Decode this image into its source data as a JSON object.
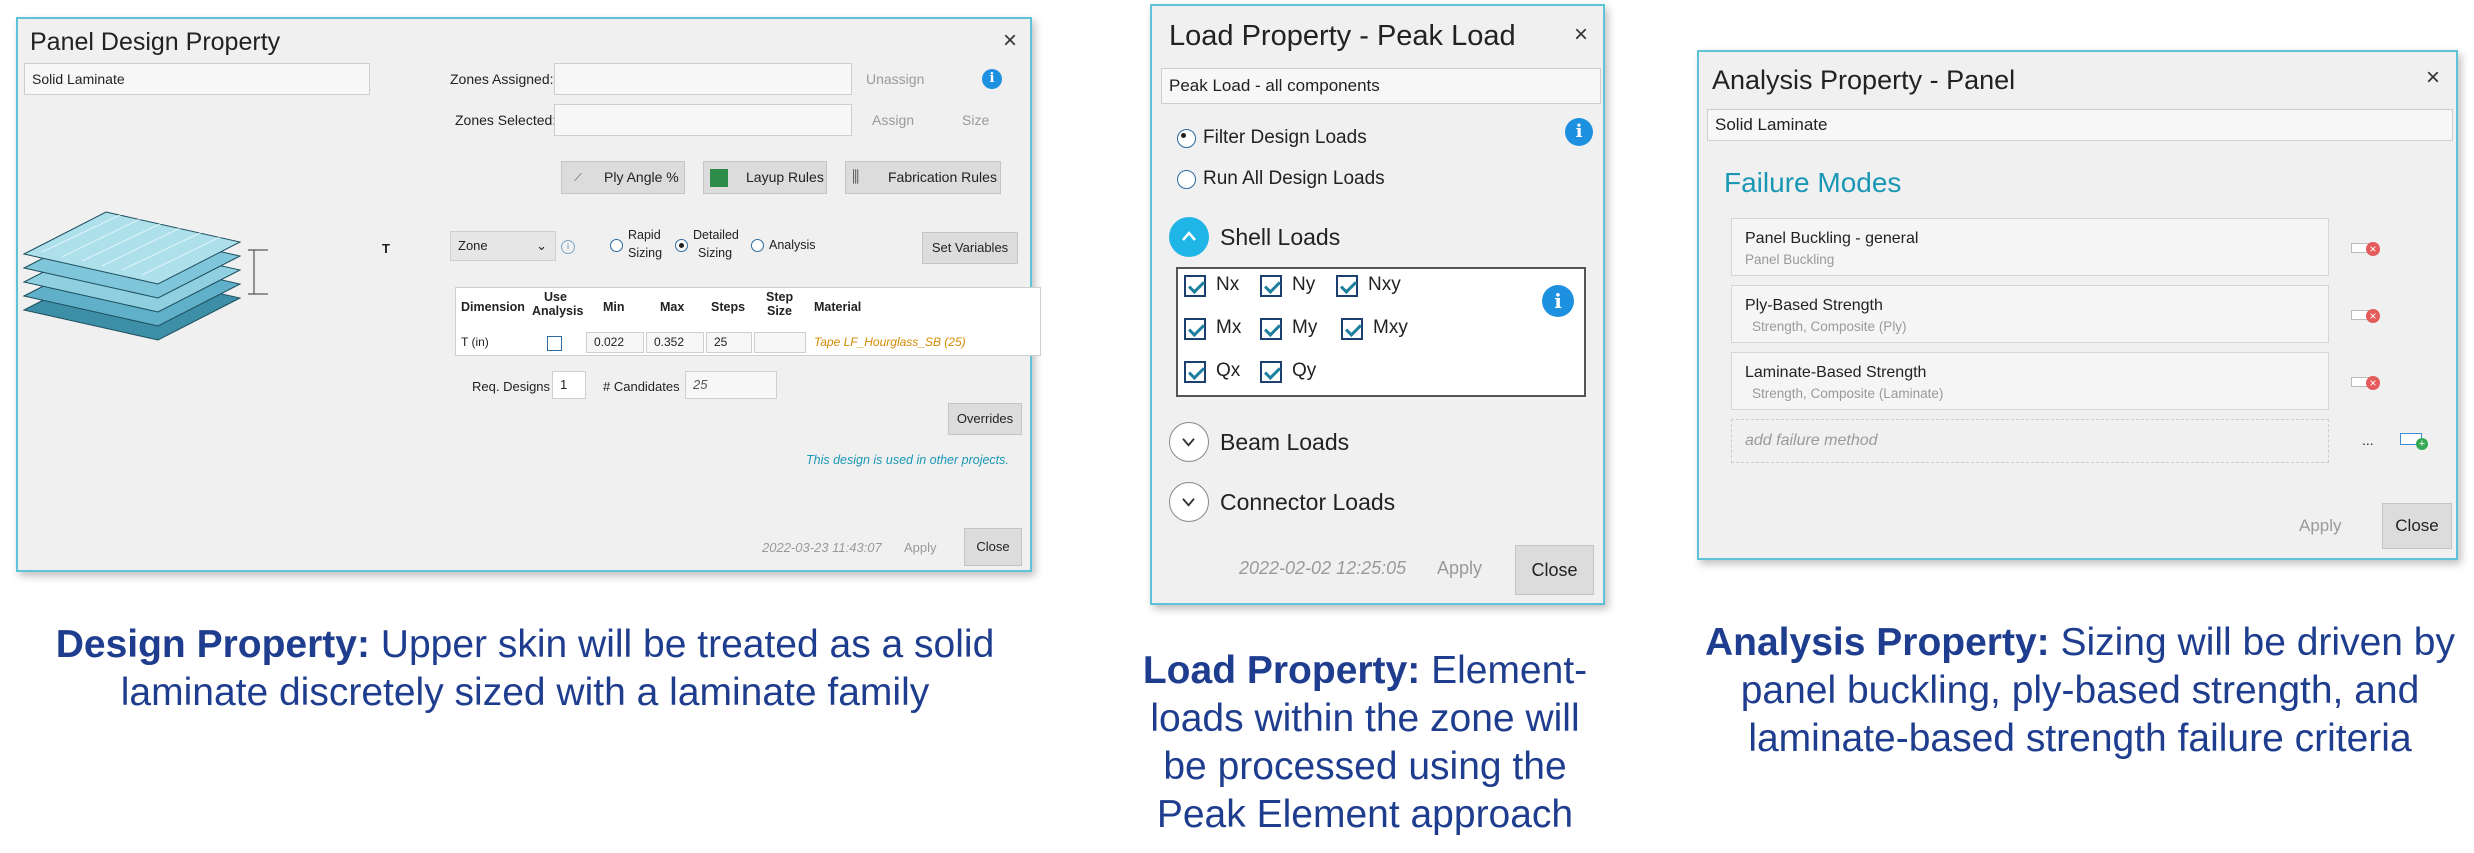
{
  "design_dialog": {
    "title": "Panel Design Property",
    "name_value": "Solid Laminate",
    "zones_assigned_label": "Zones Assigned:",
    "unassign_label": "Unassign",
    "zones_selected_label": "Zones Selected:",
    "assign_label": "Assign",
    "size_label": "Size",
    "ply_angle_label": "Ply Angle %",
    "layup_rules_label": "Layup Rules",
    "fabrication_rules_label": "Fabrication Rules",
    "thickness_tag": "T",
    "zone_select_value": "Zone",
    "rapid_sizing_label_1": "Rapid",
    "rapid_sizing_label_2": "Sizing",
    "detailed_sizing_label_1": "Detailed",
    "detailed_sizing_label_2": "Sizing",
    "analysis_radio_label": "Analysis",
    "set_variables_label": "Set Variables",
    "table_headers": {
      "dimension": "Dimension",
      "use_analysis_1": "Use",
      "use_analysis_2": "Analysis",
      "min": "Min",
      "max": "Max",
      "steps": "Steps",
      "step_size_1": "Step",
      "step_size_2": "Size",
      "material": "Material"
    },
    "table_row": {
      "dimension": "T (in)",
      "min": "0.022",
      "max": "0.352",
      "steps": "25",
      "material": "Tape LF_Hourglass_SB (25)"
    },
    "req_designs_label": "Req. Designs",
    "req_designs_value": "1",
    "candidates_label": "# Candidates",
    "candidates_value": "25",
    "overrides_label": "Overrides",
    "used_note": "This design is used in other projects.",
    "timestamp": "2022-03-23 11:43:07",
    "apply_label": "Apply",
    "close_label": "Close"
  },
  "load_dialog": {
    "title": "Load Property - Peak Load",
    "name_value": "Peak Load - all components",
    "filter_label": "Filter Design Loads",
    "run_all_label": "Run All Design Loads",
    "shell_loads_label": "Shell Loads",
    "checkboxes": [
      [
        "Nx",
        "Ny",
        "Nxy"
      ],
      [
        "Mx",
        "My",
        "Mxy"
      ],
      [
        "Qx",
        "Qy"
      ]
    ],
    "beam_loads_label": "Beam Loads",
    "connector_loads_label": "Connector Loads",
    "timestamp": "2022-02-02 12:25:05",
    "apply_label": "Apply",
    "close_label": "Close"
  },
  "analysis_dialog": {
    "title": "Analysis Property - Panel",
    "name_value": "Solid Laminate",
    "failure_modes_heading": "Failure Modes",
    "modes": [
      {
        "name": "Panel Buckling - general",
        "sub": "Panel Buckling"
      },
      {
        "name": "Ply-Based Strength",
        "sub": "Strength, Composite (Ply)"
      },
      {
        "name": "Laminate-Based Strength",
        "sub": "Strength, Composite (Laminate)"
      }
    ],
    "add_placeholder": "add failure method",
    "ellipsis": "...",
    "apply_label": "Apply",
    "close_label": "Close"
  },
  "captions": {
    "design_bold": "Design Property:",
    "design_text": "Upper skin will be treated as a solid laminate discretely sized with a laminate family",
    "load_bold": "Load Property:",
    "load_text": "Element-loads within the zone will be processed using the Peak Element approach",
    "analysis_bold": "Analysis Property:",
    "analysis_text": "Sizing will be driven by panel buckling, ply-based strength, and laminate-based strength failure criteria"
  },
  "colors": {
    "dialog_border": "#5fc3d8",
    "caption_blue": "#1f3d8f",
    "teal_heading": "#1a97b5",
    "info_blue": "#1e90e0",
    "material_orange": "#d48a00"
  }
}
